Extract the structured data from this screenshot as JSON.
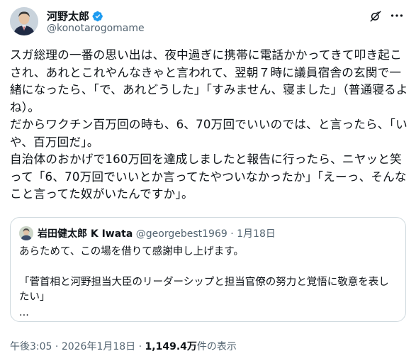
{
  "author": {
    "display_name": "河野太郎",
    "handle": "@konotarogomame"
  },
  "tweet": {
    "paragraphs": [
      "スガ総理の一番の思い出は、夜中過ぎに携帯に電話かかってきて叩き起こされ、あれとこれやんなきゃと言われて、翌朝７時に議員宿舎の玄関で一緒になったら、「で、あれどうした」「すみません、寝ました」（普通寝るよね）。",
      "だからワクチン百万回の時も、6、70万回でいいのでは、と言ったら、「いや、百万回だ」。",
      "自治体のおかげで160万回を達成しましたと報告に行ったら、ニヤッと笑って「6、70万回でいいとか言ってたやついなかったか」「えーっ、そんなこと言ってた奴がいたんですか」。"
    ]
  },
  "quote": {
    "display_name": "岩田健太郎 K Iwata",
    "handle": "@georgebest1969",
    "separator": "·",
    "date": "1月18日",
    "line1": "あらためて、この場を借りて感謝申し上げます。",
    "line2": "「菅首相と河野担当大臣のリーダーシップと担当官僚の努力と覚悟に敬意を表したい」",
    "ellipsis": "..."
  },
  "meta": {
    "time": "午後3:05",
    "separator1": "·",
    "date": "2026年1月18日",
    "separator2": "·",
    "views_count": "1,149.4万",
    "views_label": "件の表示"
  },
  "icons": {
    "verified": "verified-badge-icon",
    "grok": "grok-icon",
    "more": "more-options-icon"
  },
  "colors": {
    "accent": "#1d9bf0",
    "text": "#0f1419",
    "secondary": "#536471",
    "border": "#cfd9de"
  }
}
